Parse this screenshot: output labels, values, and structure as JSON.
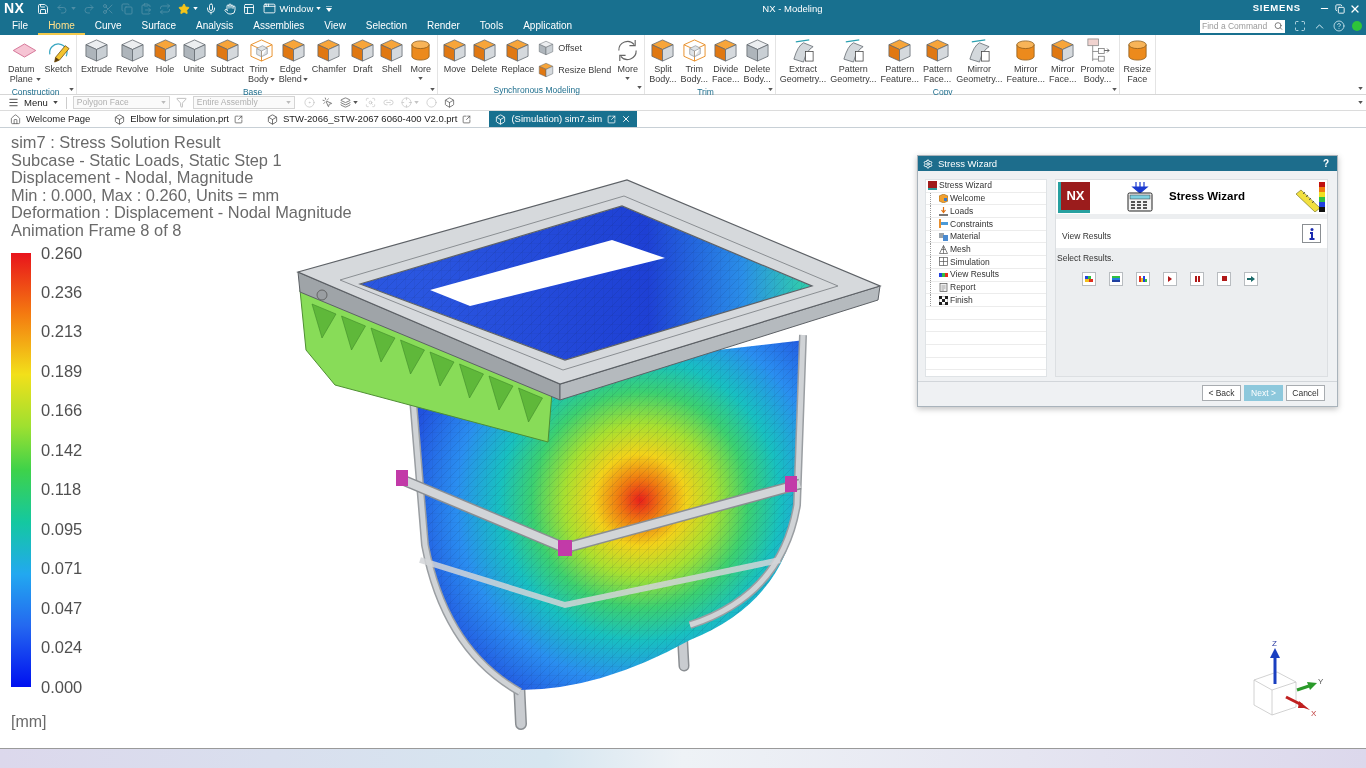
{
  "window": {
    "logo": "NX",
    "title": "NX - Modeling",
    "brand": "SIEMENS"
  },
  "quick_access": [
    {
      "kind": "save",
      "disabled": false
    },
    {
      "kind": "undo",
      "disabled": true,
      "caret": true
    },
    {
      "kind": "redo",
      "disabled": true
    },
    {
      "kind": "cut",
      "disabled": true
    },
    {
      "kind": "copy",
      "disabled": true
    },
    {
      "kind": "paste",
      "disabled": true
    },
    {
      "kind": "repeat",
      "disabled": true
    },
    {
      "kind": "favorite",
      "disabled": false,
      "caret": true
    },
    {
      "kind": "voice",
      "disabled": false
    },
    {
      "kind": "touch",
      "disabled": false
    },
    {
      "kind": "switch",
      "disabled": false
    }
  ],
  "window_menu": "Window",
  "ribbon_tabs": [
    {
      "label": "File",
      "selected": false
    },
    {
      "label": "Home",
      "selected": true
    },
    {
      "label": "Curve",
      "selected": false
    },
    {
      "label": "Surface",
      "selected": false
    },
    {
      "label": "Analysis",
      "selected": false
    },
    {
      "label": "Assemblies",
      "selected": false
    },
    {
      "label": "View",
      "selected": false
    },
    {
      "label": "Selection",
      "selected": false
    },
    {
      "label": "Render",
      "selected": false
    },
    {
      "label": "Tools",
      "selected": false
    },
    {
      "label": "Application",
      "selected": false
    }
  ],
  "command_search": {
    "placeholder": "Find a Command"
  },
  "ribbon_groups": [
    {
      "label": "Construction",
      "menu": true,
      "commands": [
        {
          "label": "Datum\nPlane",
          "kind": "plane",
          "caret": true
        },
        {
          "label": "Sketch",
          "kind": "sketch"
        }
      ]
    },
    {
      "label": "Base",
      "menu": true,
      "commands": [
        {
          "label": "Extrude",
          "kind": "cube"
        },
        {
          "label": "Revolve",
          "kind": "cube"
        },
        {
          "label": "Hole",
          "kind": "shaded-cube"
        },
        {
          "label": "Unite",
          "kind": "cube"
        },
        {
          "label": "Subtract",
          "kind": "shaded-cube"
        },
        {
          "label": "Trim\nBody",
          "kind": "wire-cube",
          "caret": true
        },
        {
          "label": "Edge\nBlend",
          "kind": "shaded-cube",
          "caret": true
        },
        {
          "label": "Chamfer",
          "kind": "shaded-cube"
        },
        {
          "label": "Draft",
          "kind": "shaded-cube"
        },
        {
          "label": "Shell",
          "kind": "shaded-cube"
        },
        {
          "label": "More",
          "kind": "cylinder",
          "caret": true
        }
      ]
    },
    {
      "label": "Synchronous Modeling",
      "menu": true,
      "commands": [
        {
          "label": "Move",
          "kind": "shaded-cube"
        },
        {
          "label": "Delete",
          "kind": "shaded-cube"
        },
        {
          "label": "Replace",
          "kind": "shaded-cube"
        },
        {
          "stack": [
            {
              "label": "Offset",
              "kind": "cube"
            },
            {
              "label": "Resize Blend",
              "kind": "shaded-cube"
            }
          ]
        },
        {
          "label": "More",
          "kind": "cycle",
          "caret": true
        }
      ]
    },
    {
      "label": "Trim",
      "menu": true,
      "commands": [
        {
          "label": "Split\nBody...",
          "kind": "shaded-cube"
        },
        {
          "label": "Trim\nBody...",
          "kind": "wire-cube"
        },
        {
          "label": "Divide\nFace...",
          "kind": "shaded-cube"
        },
        {
          "label": "Delete\nBody...",
          "kind": "cube"
        }
      ]
    },
    {
      "label": "Copy",
      "menu": true,
      "commands": [
        {
          "label": "Extract\nGeometry...",
          "kind": "sheet"
        },
        {
          "label": "Pattern\nGeometry...",
          "kind": "sheet"
        },
        {
          "label": "Pattern\nFeature...",
          "kind": "shaded-cube"
        },
        {
          "label": "Pattern\nFace...",
          "kind": "shaded-cube"
        },
        {
          "label": "Mirror\nGeometry...",
          "kind": "sheet"
        },
        {
          "label": "Mirror\nFeature...",
          "kind": "cylinder"
        },
        {
          "label": "Mirror\nFace...",
          "kind": "shaded-cube"
        },
        {
          "label": "Promote\nBody...",
          "kind": "promote"
        }
      ]
    },
    {
      "commands": [
        {
          "label": "Resize\nFace",
          "kind": "cylinder"
        }
      ]
    }
  ],
  "toolbar": {
    "menu": "Menu",
    "type_filter": {
      "value": "Polygon Face",
      "disabled": true
    },
    "scope_filter": {
      "value": "Entire Assembly",
      "disabled": true
    },
    "tools": [
      {
        "kind": "snap",
        "disabled": true
      },
      {
        "kind": "select",
        "disabled": false
      },
      {
        "kind": "layers",
        "disabled": false,
        "caret": true
      },
      {
        "kind": "zoom",
        "disabled": true
      },
      {
        "kind": "link",
        "disabled": true
      },
      {
        "kind": "point",
        "disabled": true,
        "caret": true
      },
      {
        "kind": "sphere",
        "disabled": true
      },
      {
        "kind": "box",
        "disabled": false
      }
    ]
  },
  "document_tabs": [
    {
      "label": "Welcome Page",
      "kind": "home",
      "selected": false
    },
    {
      "label": "Elbow for simulation.prt",
      "kind": "part",
      "selected": false
    },
    {
      "label": "STW-2066_STW-2067 6060-400 V2.0.prt",
      "kind": "part",
      "selected": false
    },
    {
      "label": "(Simulation) sim7.sim",
      "kind": "part",
      "selected": true
    }
  ],
  "result_info": [
    "sim7 : Stress Solution Result",
    "Subcase - Static Loads, Static Step 1",
    "Displacement - Nodal, Magnitude",
    "Min : 0.000, Max : 0.260, Units = mm",
    "Deformation : Displacement - Nodal Magnitude",
    "Animation Frame 8 of 8"
  ],
  "legend": {
    "values": [
      "0.260",
      "0.236",
      "0.213",
      "0.189",
      "0.166",
      "0.142",
      "0.118",
      "0.095",
      "0.071",
      "0.047",
      "0.024",
      "0.000"
    ],
    "unit": "[mm]"
  },
  "stress_wizard": {
    "title": "Stress Wizard",
    "help": "?",
    "tree": [
      {
        "label": "Stress Wizard",
        "kind": "root",
        "children": [
          {
            "label": "Welcome",
            "kind": "welcome"
          },
          {
            "label": "Loads",
            "kind": "loads"
          },
          {
            "label": "Constraints",
            "kind": "constraints"
          },
          {
            "label": "Material",
            "kind": "material"
          },
          {
            "label": "Mesh",
            "kind": "mesh"
          },
          {
            "label": "Simulation",
            "kind": "simulation"
          },
          {
            "label": "View Results",
            "kind": "results"
          },
          {
            "label": "Report",
            "kind": "report"
          },
          {
            "label": "Finish",
            "kind": "finish"
          }
        ]
      }
    ],
    "header": {
      "logo": "NX",
      "title": "Stress Wizard"
    },
    "page_title": "View Results",
    "prompt": "Select Results.",
    "buttons": [
      {
        "label": "< Back",
        "default": false
      },
      {
        "label": "Next >",
        "default": true
      },
      {
        "label": "Cancel",
        "default": false
      }
    ]
  },
  "view_triad": {
    "z": "Z",
    "y": "Y",
    "x": "X"
  }
}
